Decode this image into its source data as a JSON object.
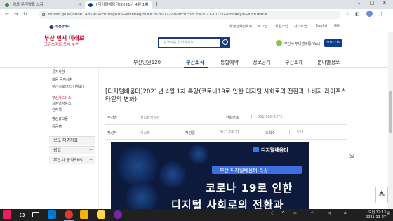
{
  "browser": {
    "tabs": [
      {
        "label": "위로 우리말을 쓰자"
      },
      {
        "label": "[디지털배움터]2021년 4월 1차"
      }
    ],
    "url": "busan.go.kr/nhot/1485914?curPage=5&srchBeginDt=2020-11-27&srchEndDt=2021-11-27&srchKey=&srchText=",
    "new_tab": "+"
  },
  "site": {
    "logo_text": "부산광역시",
    "util_links": [
      "행정전화번호부",
      "로그인",
      "회원가입",
      "사이트맵"
    ],
    "lang": "English",
    "lang_go": "GO",
    "banner_line1": "부산 먼저 미래로",
    "banner_line2": "그린스마트 도시 부산",
    "search_placeholder": "검색어를 입력하세요.",
    "mascot_label": "부산시 부비앤빠통(Ver.)",
    "kor_button": "코로나19",
    "nav": [
      "부산민원120",
      "부산소식",
      "통합예약",
      "정보공개",
      "부산소개",
      "분야별정보"
    ]
  },
  "sidebar": {
    "items": [
      "공지사항",
      "채용 공지사항",
      "부산시보(미디어자료)",
      "부산카드뉴스",
      "시정영상뉴스",
      "전자책",
      "영상홍보물",
      "공공캠"
    ],
    "sections": [
      "보도·해명자료",
      "광고",
      "부산시 공식SNS"
    ]
  },
  "post": {
    "title": "[디지털배움터]2021년 4월 1차 특강(코로나19로 인한 디지털 사회로의 전환과 소비자 라이프스타일의 변화)",
    "meta": {
      "dept_label": "부서명",
      "dept": "정보화담당관",
      "phone_label": "전화번호",
      "phone": "051-888-2372",
      "author_label": "작성자",
      "author": "이상희",
      "date_label": "작성일",
      "date": "2021-04-21",
      "views_label": "조회수",
      "views": "523"
    }
  },
  "poster": {
    "brand": "디지털배움터",
    "pill": "부산 디지털배움터 특강",
    "line1": "코로나 19로 인한",
    "line2": "디지털 사회로의 전환과"
  },
  "top_button": {
    "arrow": "▲",
    "label": "TOP"
  },
  "taskbar": {
    "time": "오전 12:13",
    "date": "2021-11-27"
  }
}
